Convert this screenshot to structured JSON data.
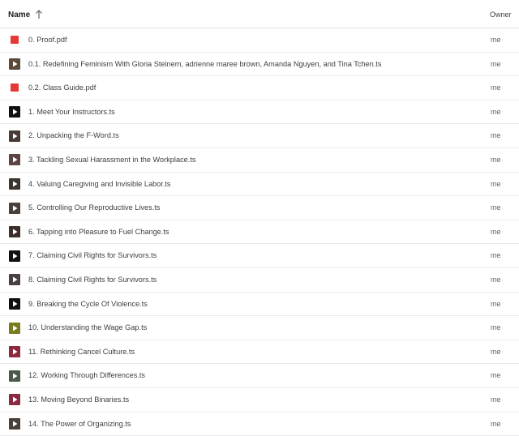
{
  "header": {
    "name_label": "Name",
    "owner_label": "Owner"
  },
  "colors": {
    "pdf": "#e53935",
    "thumb_dark": "#222222"
  },
  "files": [
    {
      "name": "0. Proof.pdf",
      "owner": "me",
      "icon": "pdf-icon",
      "thumb": ""
    },
    {
      "name": "0.1. Redefining Feminism With Gloria Steinem, adrienne maree brown, Amanda Nguyen, and Tina Tchen.ts",
      "owner": "me",
      "icon": "video-icon",
      "thumb": "#5a4a3a"
    },
    {
      "name": "0.2. Class Guide.pdf",
      "owner": "me",
      "icon": "pdf-icon",
      "thumb": ""
    },
    {
      "name": "1. Meet Your Instructors.ts",
      "owner": "me",
      "icon": "video-icon",
      "thumb": "#111111"
    },
    {
      "name": "2. Unpacking the F-Word.ts",
      "owner": "me",
      "icon": "video-icon",
      "thumb": "#4a3a35"
    },
    {
      "name": "3. Tackling Sexual Harassment in the Workplace.ts",
      "owner": "me",
      "icon": "video-icon",
      "thumb": "#5a4540"
    },
    {
      "name": "4. Valuing Caregiving and Invisible Labor.ts",
      "owner": "me",
      "icon": "video-icon",
      "thumb": "#3a3530"
    },
    {
      "name": "5. Controlling Our Reproductive Lives.ts",
      "owner": "me",
      "icon": "video-icon",
      "thumb": "#4a4038"
    },
    {
      "name": "6. Tapping into Pleasure to Fuel Change.ts",
      "owner": "me",
      "icon": "video-icon",
      "thumb": "#3d2e2a"
    },
    {
      "name": "7. Claiming Civil Rights for Survivors.ts",
      "owner": "me",
      "icon": "video-icon",
      "thumb": "#111111"
    },
    {
      "name": "8. Claiming Civil Rights for Survivors.ts",
      "owner": "me",
      "icon": "video-icon",
      "thumb": "#4a4040"
    },
    {
      "name": "9. Breaking the Cycle Of Violence.ts",
      "owner": "me",
      "icon": "video-icon",
      "thumb": "#111111"
    },
    {
      "name": "10. Understanding the Wage Gap.ts",
      "owner": "me",
      "icon": "video-icon",
      "thumb": "#7a7a20"
    },
    {
      "name": "11. Rethinking Cancel Culture.ts",
      "owner": "me",
      "icon": "video-icon",
      "thumb": "#8a2a3a"
    },
    {
      "name": "12. Working Through Differences.ts",
      "owner": "me",
      "icon": "video-icon",
      "thumb": "#4a5a4a"
    },
    {
      "name": "13. Moving Beyond Binaries.ts",
      "owner": "me",
      "icon": "video-icon",
      "thumb": "#8a2a40"
    },
    {
      "name": "14. The Power of Organizing.ts",
      "owner": "me",
      "icon": "video-icon",
      "thumb": "#4a4038"
    }
  ]
}
